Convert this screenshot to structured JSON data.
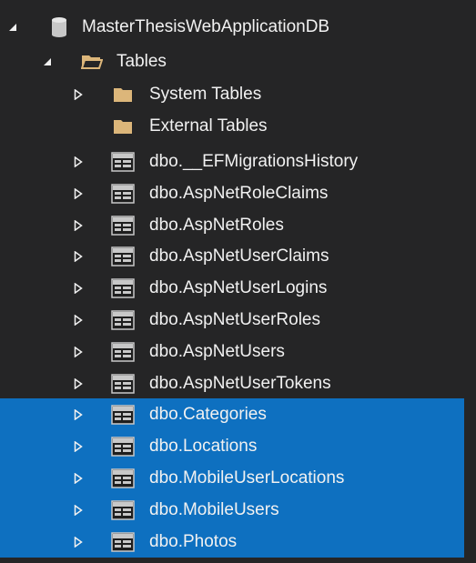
{
  "tree": {
    "database": {
      "label": "MasterThesisWebApplicationDB",
      "icon": "database-icon",
      "expanded": true
    },
    "tables_folder": {
      "label": "Tables",
      "icon": "open-folder-icon",
      "expanded": true
    },
    "folders": [
      {
        "label": "System Tables",
        "icon": "folder-icon",
        "has_children": true
      },
      {
        "label": "External Tables",
        "icon": "folder-icon",
        "has_children": false
      }
    ],
    "tables": [
      {
        "label": "dbo.__EFMigrationsHistory",
        "icon": "table-icon",
        "selected": false
      },
      {
        "label": "dbo.AspNetRoleClaims",
        "icon": "table-icon",
        "selected": false
      },
      {
        "label": "dbo.AspNetRoles",
        "icon": "table-icon",
        "selected": false
      },
      {
        "label": "dbo.AspNetUserClaims",
        "icon": "table-icon",
        "selected": false
      },
      {
        "label": "dbo.AspNetUserLogins",
        "icon": "table-icon",
        "selected": false
      },
      {
        "label": "dbo.AspNetUserRoles",
        "icon": "table-icon",
        "selected": false
      },
      {
        "label": "dbo.AspNetUsers",
        "icon": "table-icon",
        "selected": false
      },
      {
        "label": "dbo.AspNetUserTokens",
        "icon": "table-icon",
        "selected": false
      },
      {
        "label": "dbo.Categories",
        "icon": "table-icon",
        "selected": true
      },
      {
        "label": "dbo.Locations",
        "icon": "table-icon",
        "selected": true
      },
      {
        "label": "dbo.MobileUserLocations",
        "icon": "table-icon",
        "selected": true
      },
      {
        "label": "dbo.MobileUsers",
        "icon": "table-icon",
        "selected": true
      },
      {
        "label": "dbo.Photos",
        "icon": "table-icon",
        "selected": true
      }
    ]
  },
  "colors": {
    "background": "#252526",
    "selection": "#0e70c0",
    "text": "#f1f1f1",
    "folder": "#dcb67a"
  }
}
